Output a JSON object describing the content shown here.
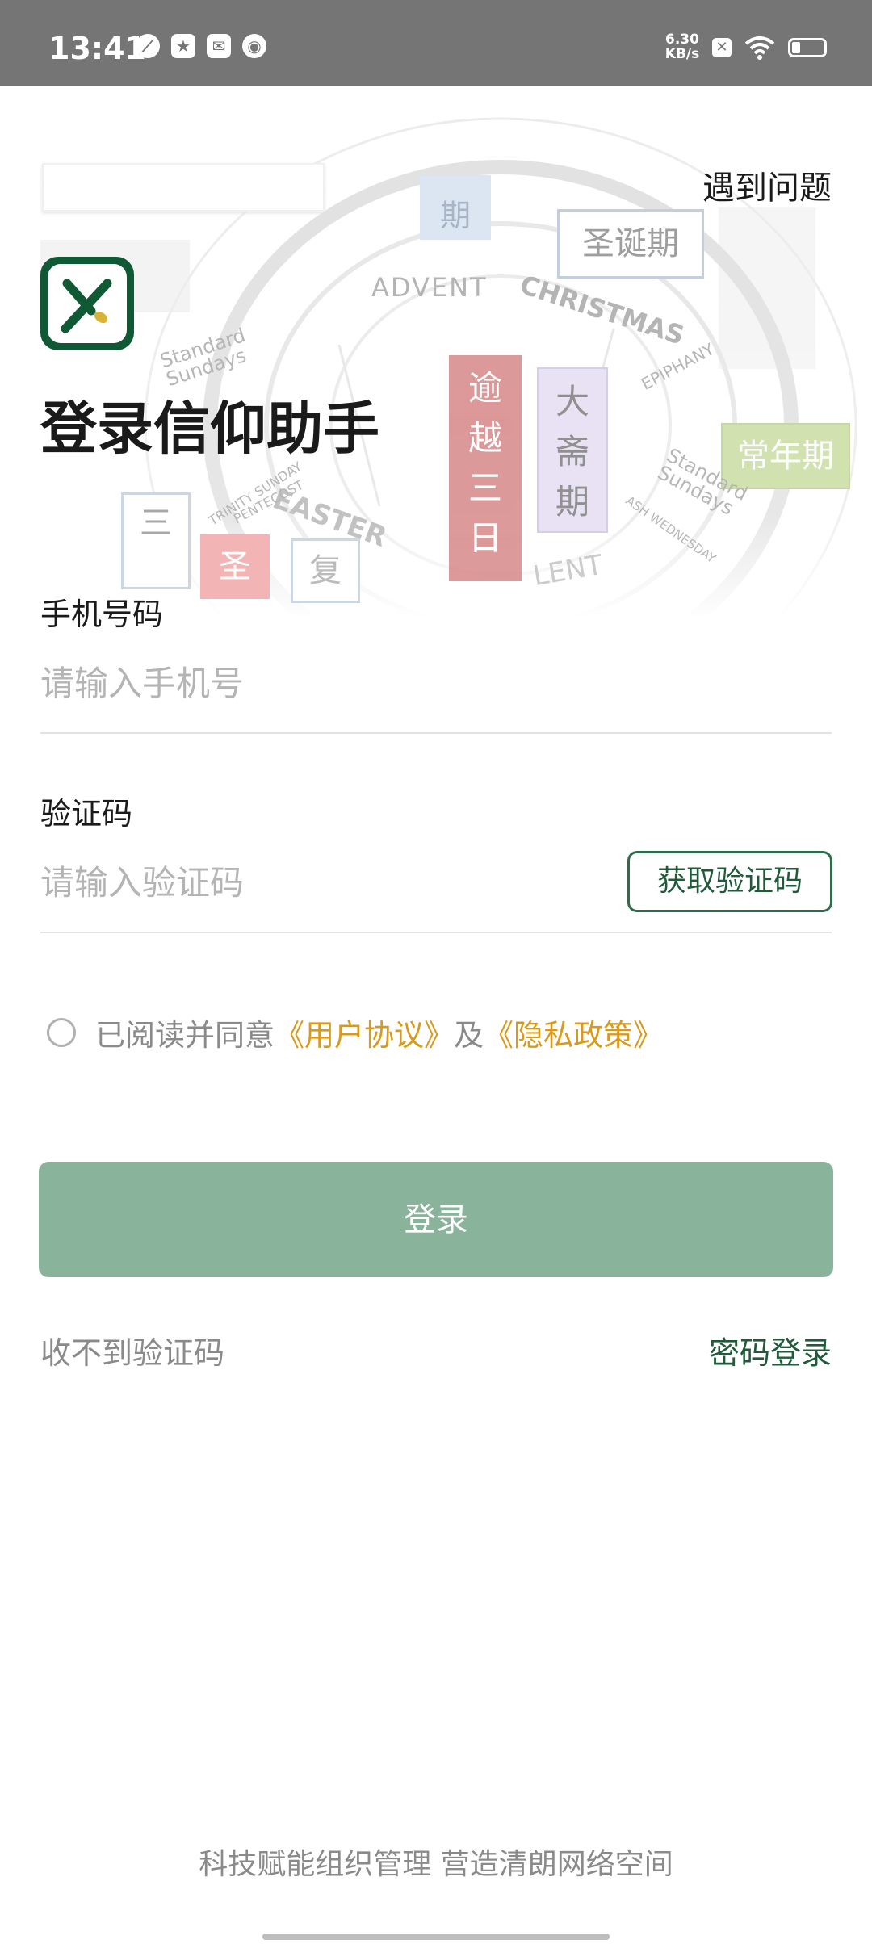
{
  "status_bar": {
    "time": "13:41",
    "speed_value": "6.30",
    "speed_unit": "KB/s",
    "icons": [
      "leaf-icon",
      "star-msg-icon",
      "mail-icon",
      "owl-icon",
      "x-notify-icon",
      "wifi-icon",
      "battery-icon"
    ]
  },
  "background_art": {
    "labels": [
      "期",
      "圣诞期",
      "ADVENT",
      "CHRISTMAS",
      "EPIPHANY",
      "Standard Sundays",
      "逾",
      "越",
      "三",
      "日",
      "大",
      "斋",
      "期",
      "常年期",
      "Standard Sundays",
      "三",
      "圣",
      "复",
      "EASTER",
      "LENT",
      "TRINITY SUNDAY",
      "PENTECOST",
      "ASH WEDNESDAY"
    ]
  },
  "header": {
    "help_link": "遇到问题",
    "title": "登录信仰助手",
    "logo_colors": {
      "frame": "#0f5a35",
      "accent": "#d9b238"
    }
  },
  "form": {
    "phone_label": "手机号码",
    "phone_placeholder": "请输入手机号",
    "code_label": "验证码",
    "code_placeholder": "请输入验证码",
    "get_code_button": "获取验证码",
    "agree_prefix": "已阅读并同意",
    "user_agreement": "《用户协议》",
    "agree_and": "及",
    "privacy_policy": "《隐私政策》",
    "login_button": "登录",
    "no_code_link": "收不到验证码",
    "password_login_link": "密码登录"
  },
  "footer": {
    "slogan": "科技赋能组织管理 营造清朗网络空间"
  },
  "colors": {
    "brand_green": "#1f5a3a",
    "button_green": "#8ab39c",
    "link_gold": "#d99a1c",
    "status_bar": "#757575"
  }
}
